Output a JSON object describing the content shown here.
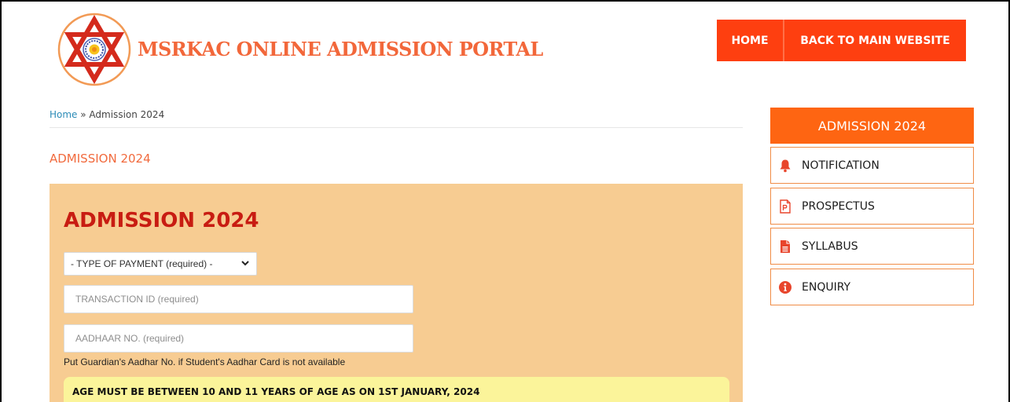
{
  "header": {
    "site_title": "MSRKAC ONLINE ADMISSION PORTAL",
    "nav": {
      "home": "HOME",
      "back": "BACK TO MAIN WEBSITE"
    }
  },
  "breadcrumb": {
    "home": "Home",
    "separator": " » ",
    "current": "Admission 2024"
  },
  "page_heading": "ADMISSION 2024",
  "form": {
    "title": "ADMISSION 2024",
    "payment_type": {
      "selected": "- TYPE OF PAYMENT (required) -"
    },
    "transaction_id": {
      "placeholder": "TRANSACTION ID (required)"
    },
    "aadhaar": {
      "placeholder": "AADHAAR NO. (required)"
    },
    "aadhaar_hint": "Put Guardian's Aadhar No. if Student's Aadhar Card is not available",
    "age_notice": "AGE MUST BE BETWEEN 10 AND 11 YEARS OF AGE AS ON 1ST JANUARY, 2024"
  },
  "sidebar": {
    "heading": "ADMISSION 2024",
    "items": [
      {
        "label": "NOTIFICATION",
        "icon": "bell-icon"
      },
      {
        "label": "PROSPECTUS",
        "icon": "document-p-icon"
      },
      {
        "label": "SYLLABUS",
        "icon": "file-text-icon"
      },
      {
        "label": "ENQUIRY",
        "icon": "info-icon"
      }
    ]
  },
  "colors": {
    "accent": "#fe3f10",
    "sidebar_header": "#fe6512",
    "form_bg": "#f7cc92",
    "form_title": "#c81c12",
    "notice_bg": "#fbf49a"
  }
}
